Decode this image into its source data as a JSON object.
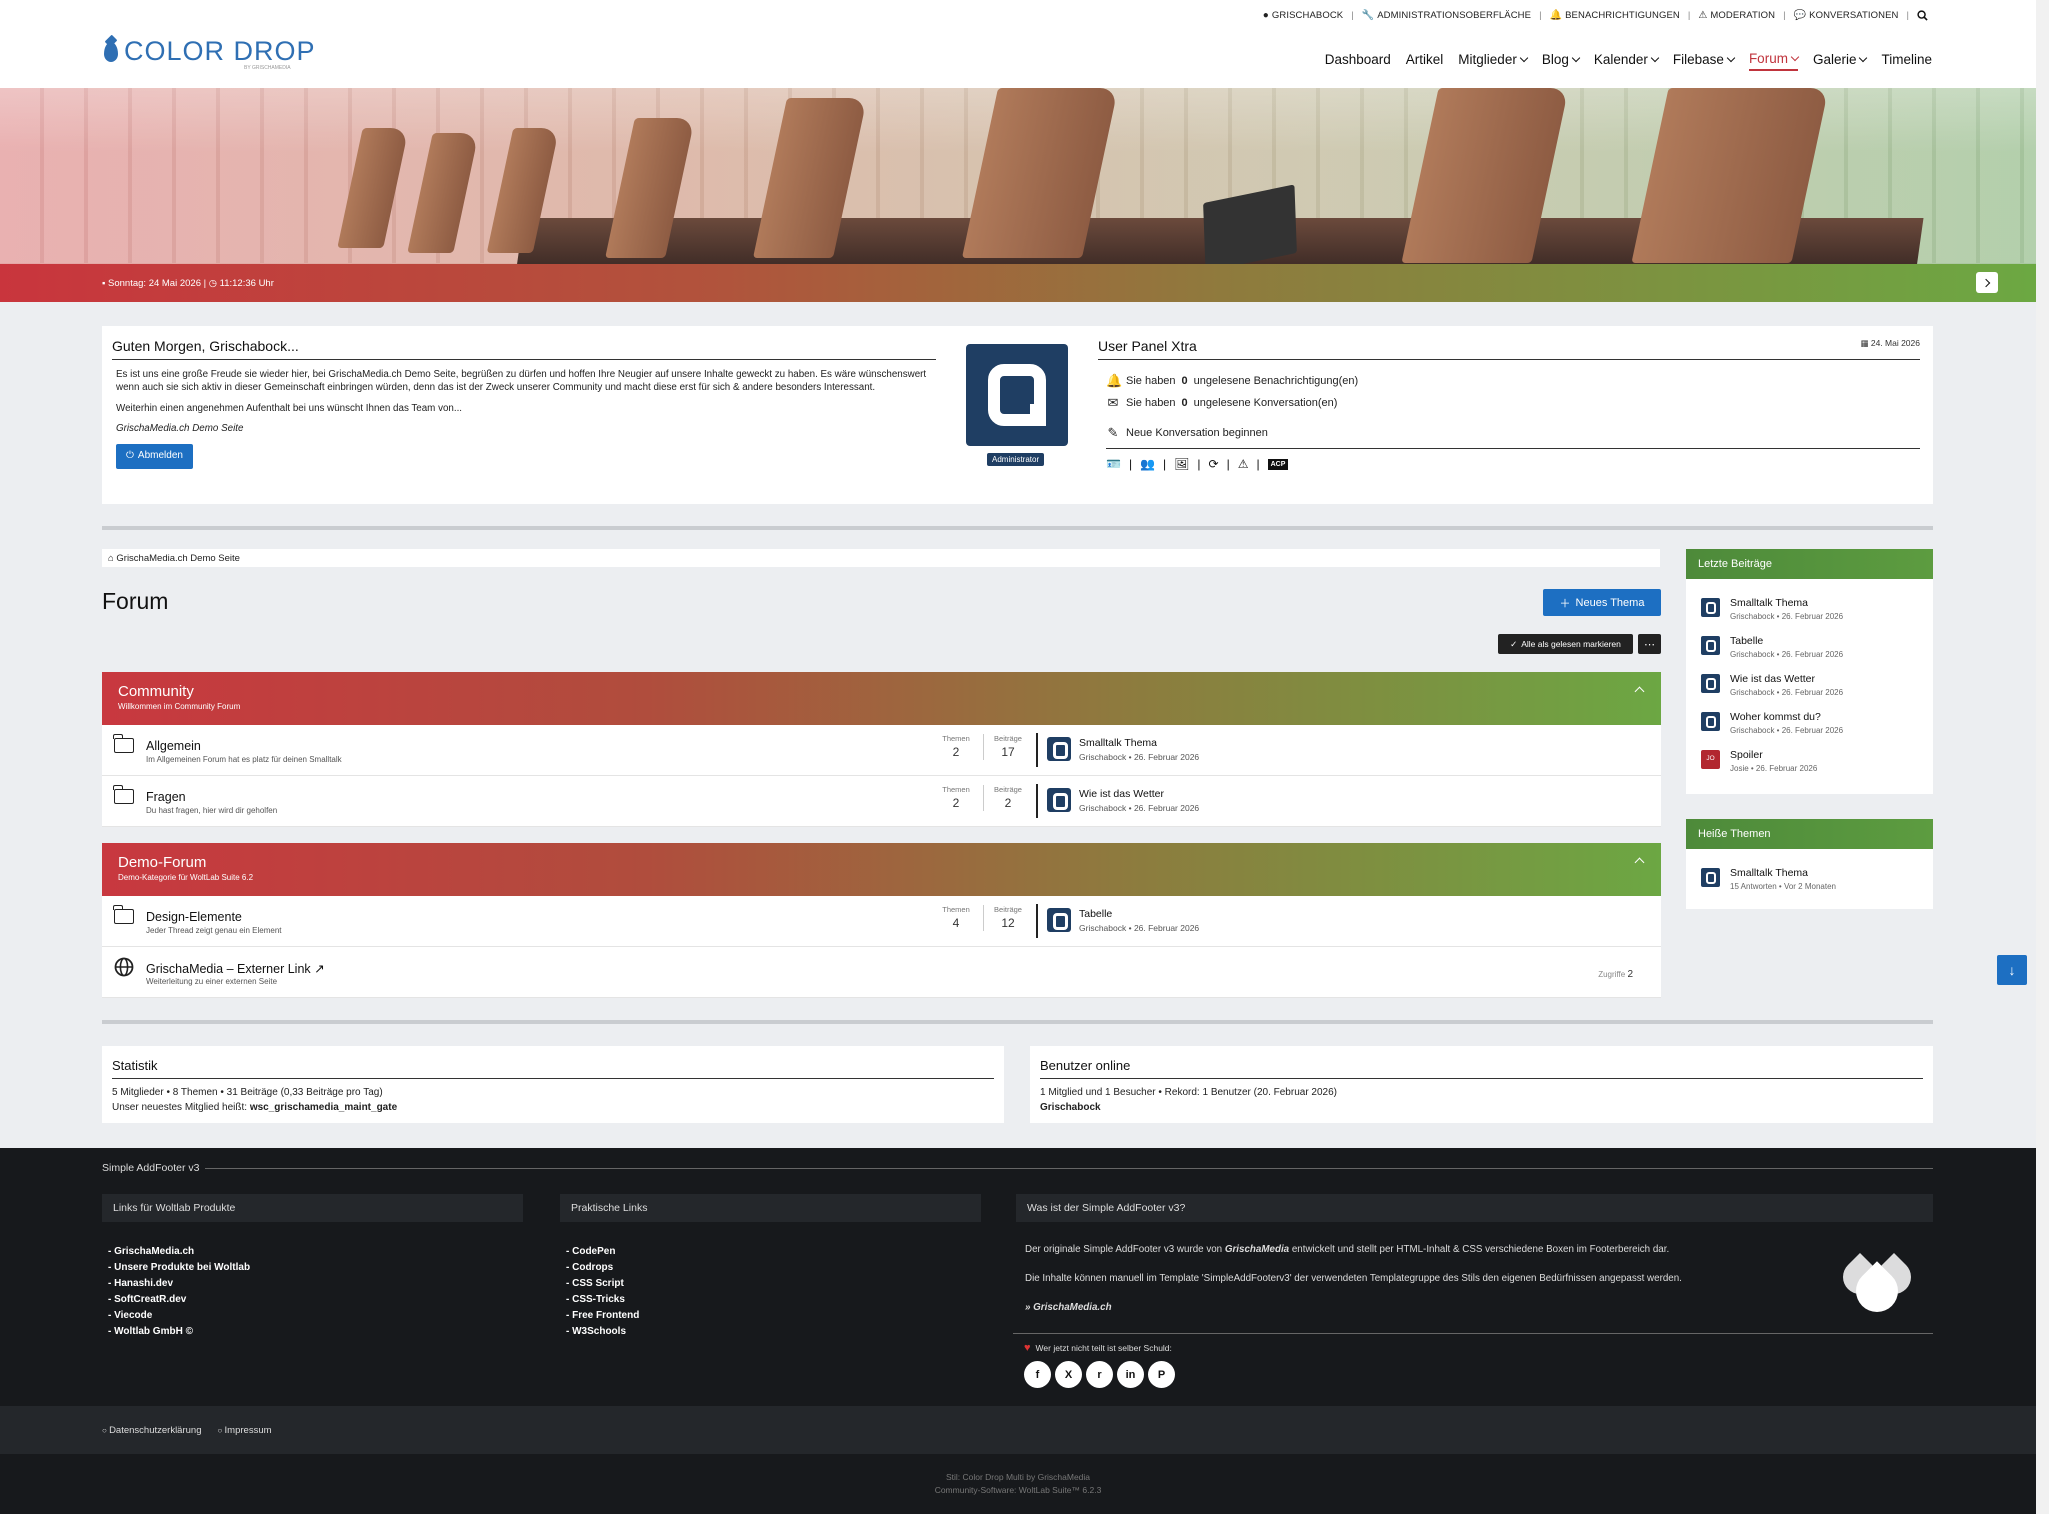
{
  "userbar": {
    "items": [
      {
        "icon": "user-circle-icon",
        "label": "GRISCHABOCK"
      },
      {
        "icon": "wrench-icon",
        "label": "ADMINISTRATIONSOBERFLÄCHE"
      },
      {
        "icon": "bell-icon",
        "label": "BENACHRICHTIGUNGEN"
      },
      {
        "icon": "warning-icon",
        "label": "MODERATION"
      },
      {
        "icon": "comments-icon",
        "label": "KONVERSATIONEN"
      }
    ]
  },
  "logo": {
    "text": "COLOR DROP",
    "sub": "BY GRISCHAMEDIA",
    "color": "#2f6fb3"
  },
  "nav": {
    "items": [
      {
        "label": "Dashboard"
      },
      {
        "label": "Artikel"
      },
      {
        "label": "Mitglieder"
      },
      {
        "label": "Blog"
      },
      {
        "label": "Kalender"
      },
      {
        "label": "Filebase"
      },
      {
        "label": "Forum"
      },
      {
        "label": "Galerie"
      },
      {
        "label": "Timeline"
      }
    ],
    "active": "Forum",
    "active_color": "#c0343d"
  },
  "hero": {
    "date_text": "Sonntag: 24 Mai 2026 | ◷ 11:12:36 Uhr"
  },
  "welcome": {
    "title": "Guten Morgen, Grischabock...",
    "p1": "Es ist uns eine große Freude sie wieder hier, bei GrischaMedia.ch Demo Seite, begrüßen zu dürfen und hoffen Ihre Neugier auf unsere Inhalte geweckt zu haben. Es wäre wünschenswert wenn auch sie sich aktiv in dieser Gemeinschaft einbringen würden, denn das ist der Zweck unserer Community und macht diese erst für sich & andere besonders Interessant.",
    "p2": "Weiterhin einen angenehmen Aufenthalt bei uns wünscht Ihnen das Team von...",
    "signature": "GrischaMedia.ch Demo Seite",
    "logout_label": "Abmelden",
    "badge": "Administrator"
  },
  "user_panel": {
    "title": "User Panel Xtra",
    "date": "24. Mai 2026",
    "notif_pre": "Sie haben",
    "notif_count": "0",
    "notif_post": "ungelesene Benachrichtigung(en)",
    "conv_pre": "Sie haben",
    "conv_count": "0",
    "conv_post": "ungelesene Konversation(en)",
    "new_conv": "Neue Konversation beginnen",
    "acp": "ACP"
  },
  "breadcrumb": {
    "home": "GrischaMedia.ch Demo Seite"
  },
  "forum": {
    "title": "Forum",
    "new_thread": "Neues Thema",
    "mark_read": "Alle als gelesen markieren",
    "stat_threads": "Themen",
    "stat_posts": "Beiträge",
    "hits_label": "Zugriffe",
    "categories": [
      {
        "title": "Community",
        "subtitle": "Willkommen im Community Forum",
        "boards": [
          {
            "name": "Allgemein",
            "desc": "Im Allgemeinen Forum hat es platz für deinen Smalltalk",
            "threads": "2",
            "posts": "17",
            "last_title": "Smalltalk Thema",
            "last_meta": "Grischabock • 26. Februar 2026"
          },
          {
            "name": "Fragen",
            "desc": "Du hast fragen, hier wird dir geholfen",
            "threads": "2",
            "posts": "2",
            "last_title": "Wie ist das Wetter",
            "last_meta": "Grischabock • 26. Februar 2026"
          }
        ]
      },
      {
        "title": "Demo-Forum",
        "subtitle": "Demo-Kategorie für WoltLab Suite 6.2",
        "boards": [
          {
            "name": "Design-Elemente",
            "desc": "Jeder Thread zeigt genau ein Element",
            "threads": "4",
            "posts": "12",
            "last_title": "Tabelle",
            "last_meta": "Grischabock • 26. Februar 2026"
          },
          {
            "name": "GrischaMedia – Externer Link ↗",
            "desc": "Weiterleitung zu einer externen Seite",
            "hits": "2"
          }
        ]
      }
    ]
  },
  "sidebar": {
    "latest_title": "Letzte Beiträge",
    "latest": [
      {
        "title": "Smalltalk Thema",
        "meta": "Grischabock • 26. Februar 2026"
      },
      {
        "title": "Tabelle",
        "meta": "Grischabock • 26. Februar 2026"
      },
      {
        "title": "Wie ist das Wetter",
        "meta": "Grischabock • 26. Februar 2026"
      },
      {
        "title": "Woher kommst du?",
        "meta": "Grischabock • 26. Februar 2026"
      },
      {
        "title": "Spoiler",
        "meta": "Josie • 26. Februar 2026",
        "avatar_text": "JO"
      }
    ],
    "hot_title": "Heiße Themen",
    "hot": [
      {
        "title": "Smalltalk Thema",
        "meta": "15 Antworten • Vor 2 Monaten"
      }
    ]
  },
  "stats": {
    "title": "Statistik",
    "line1": "5 Mitglieder  •  8 Themen  •  31 Beiträge (0,33 Beiträge pro Tag)",
    "line2_pre": "Unser neuestes Mitglied heißt: ",
    "newest": "wsc_grischamedia_maint_gate"
  },
  "online": {
    "title": "Benutzer online",
    "line1": "1 Mitglied und 1 Besucher  •  Rekord: 1 Benutzer (20. Februar 2026)",
    "user": "Grischabock"
  },
  "footer": {
    "title": "Simple AddFooter v3",
    "col1_title": "Links für Woltlab Produkte",
    "col1": [
      "GrischaMedia.ch",
      "Unsere Produkte bei Woltlab",
      "Hanashi.dev",
      "SoftCreatR.dev",
      "Viecode",
      "Woltlab GmbH ©"
    ],
    "col2_title": "Praktische Links",
    "col2": [
      "CodePen",
      "Codrops",
      "CSS Script",
      "CSS-Tricks",
      "Free Frontend",
      "W3Schools"
    ],
    "col3_title": "Was ist der Simple AddFooter v3?",
    "col3_p1_pre": "Der originale Simple AddFooter v3 wurde von ",
    "col3_p1_brand": "GrischaMedia",
    "col3_p1_post": " entwickelt und stellt per HTML-Inhalt & CSS verschiedene Boxen im Footerbereich dar.",
    "col3_p2": "Die Inhalte können manuell im Template 'SimpleAddFooterv3' der verwendeten Templategruppe des Stils den eigenen Bedürfnissen angepasst werden.",
    "col3_link": "» GrischaMedia.ch",
    "share_text": "Wer jetzt nicht teilt ist selber Schuld:",
    "socials": [
      "f",
      "X",
      "r",
      "in",
      "P"
    ],
    "bottom_links": [
      "Datenschutzerklärung",
      "Impressum"
    ],
    "copy1": "Stil: Color Drop Multi by GrischaMedia",
    "copy2": "Community-Software: WoltLab Suite™ 6.2.3"
  }
}
